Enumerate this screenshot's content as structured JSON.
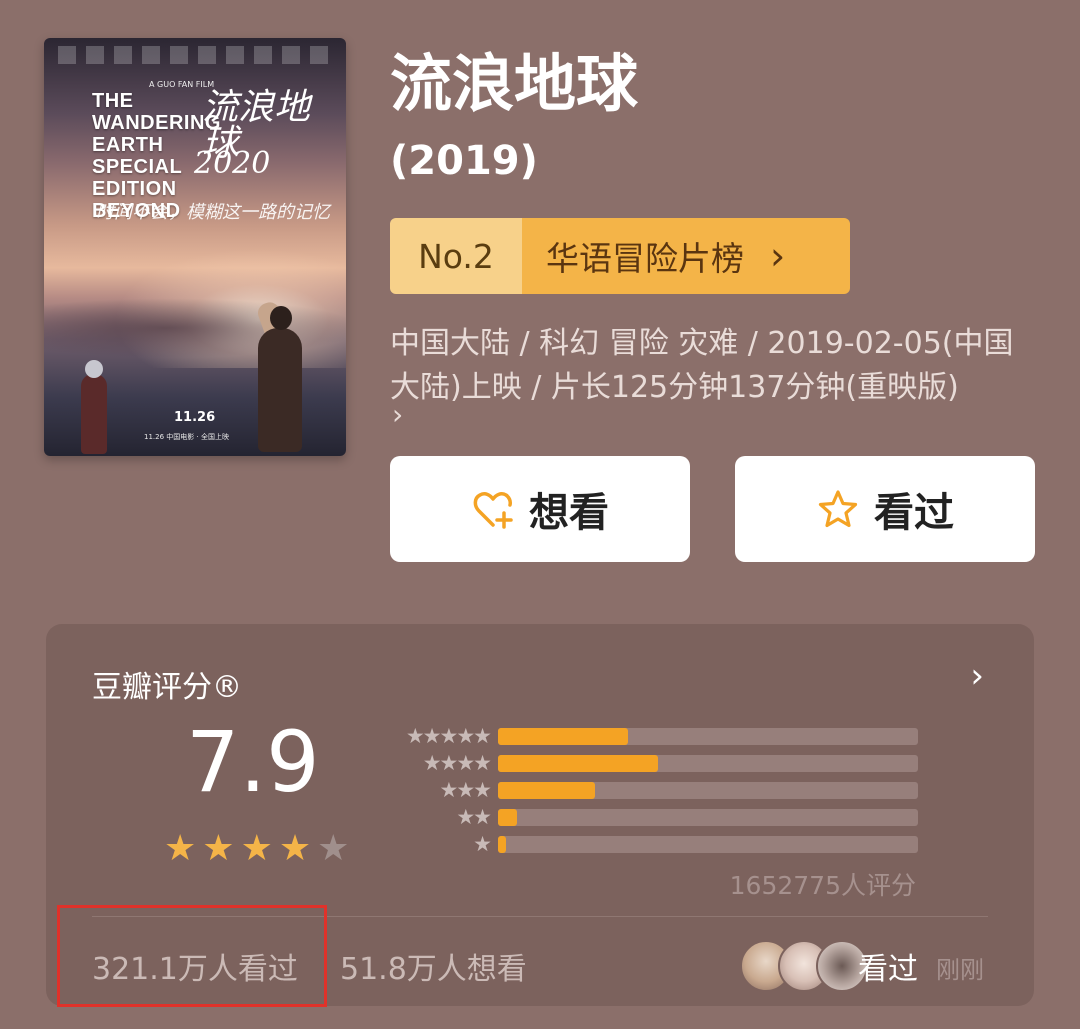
{
  "movie": {
    "title": "流浪地球",
    "year": "(2019)",
    "poster": {
      "title_en": "THE WANDERING EARTH SPECIAL EDITION BEYOND",
      "title_cn": "流浪地球",
      "year_text": "2020",
      "handwriting": "时间不会，模糊这一路的记忆",
      "date": "11.26",
      "small_credit": "A GUO FAN FILM",
      "footer": "11.26 中国电影 · 全国上映"
    },
    "rank": {
      "number": "No.2",
      "list_name": "华语冒险片榜",
      "chevron": "›"
    },
    "info_text": "中国大陆 / 科幻 冒险 灾难 / 2019-02-05(中国大陆)上映 / 片长125分钟137分钟(重映版)",
    "info_chevron": "›"
  },
  "actions": {
    "want_label": "想看",
    "seen_label": "看过"
  },
  "rating": {
    "section_title": "豆瓣评分®",
    "chevron": "›",
    "score": "7.9",
    "stars": 4,
    "stars_max": 5,
    "distribution": [
      {
        "label": "★★★★★",
        "fraction": 0.31
      },
      {
        "label": "★★★★",
        "fraction": 0.38
      },
      {
        "label": "★★★",
        "fraction": 0.23
      },
      {
        "label": "★★",
        "fraction": 0.045
      },
      {
        "label": "★",
        "fraction": 0.02
      }
    ],
    "count_text": "1652775人评分",
    "watched_text": "321.1万人看过",
    "wanted_text": "51.8万人想看",
    "recent_label": "看过",
    "recent_time": "刚刚"
  },
  "colors": {
    "background": "#8b6f6a",
    "panel": "#7c625d",
    "accent": "#f4b448",
    "highlight_box": "#e0322a"
  }
}
